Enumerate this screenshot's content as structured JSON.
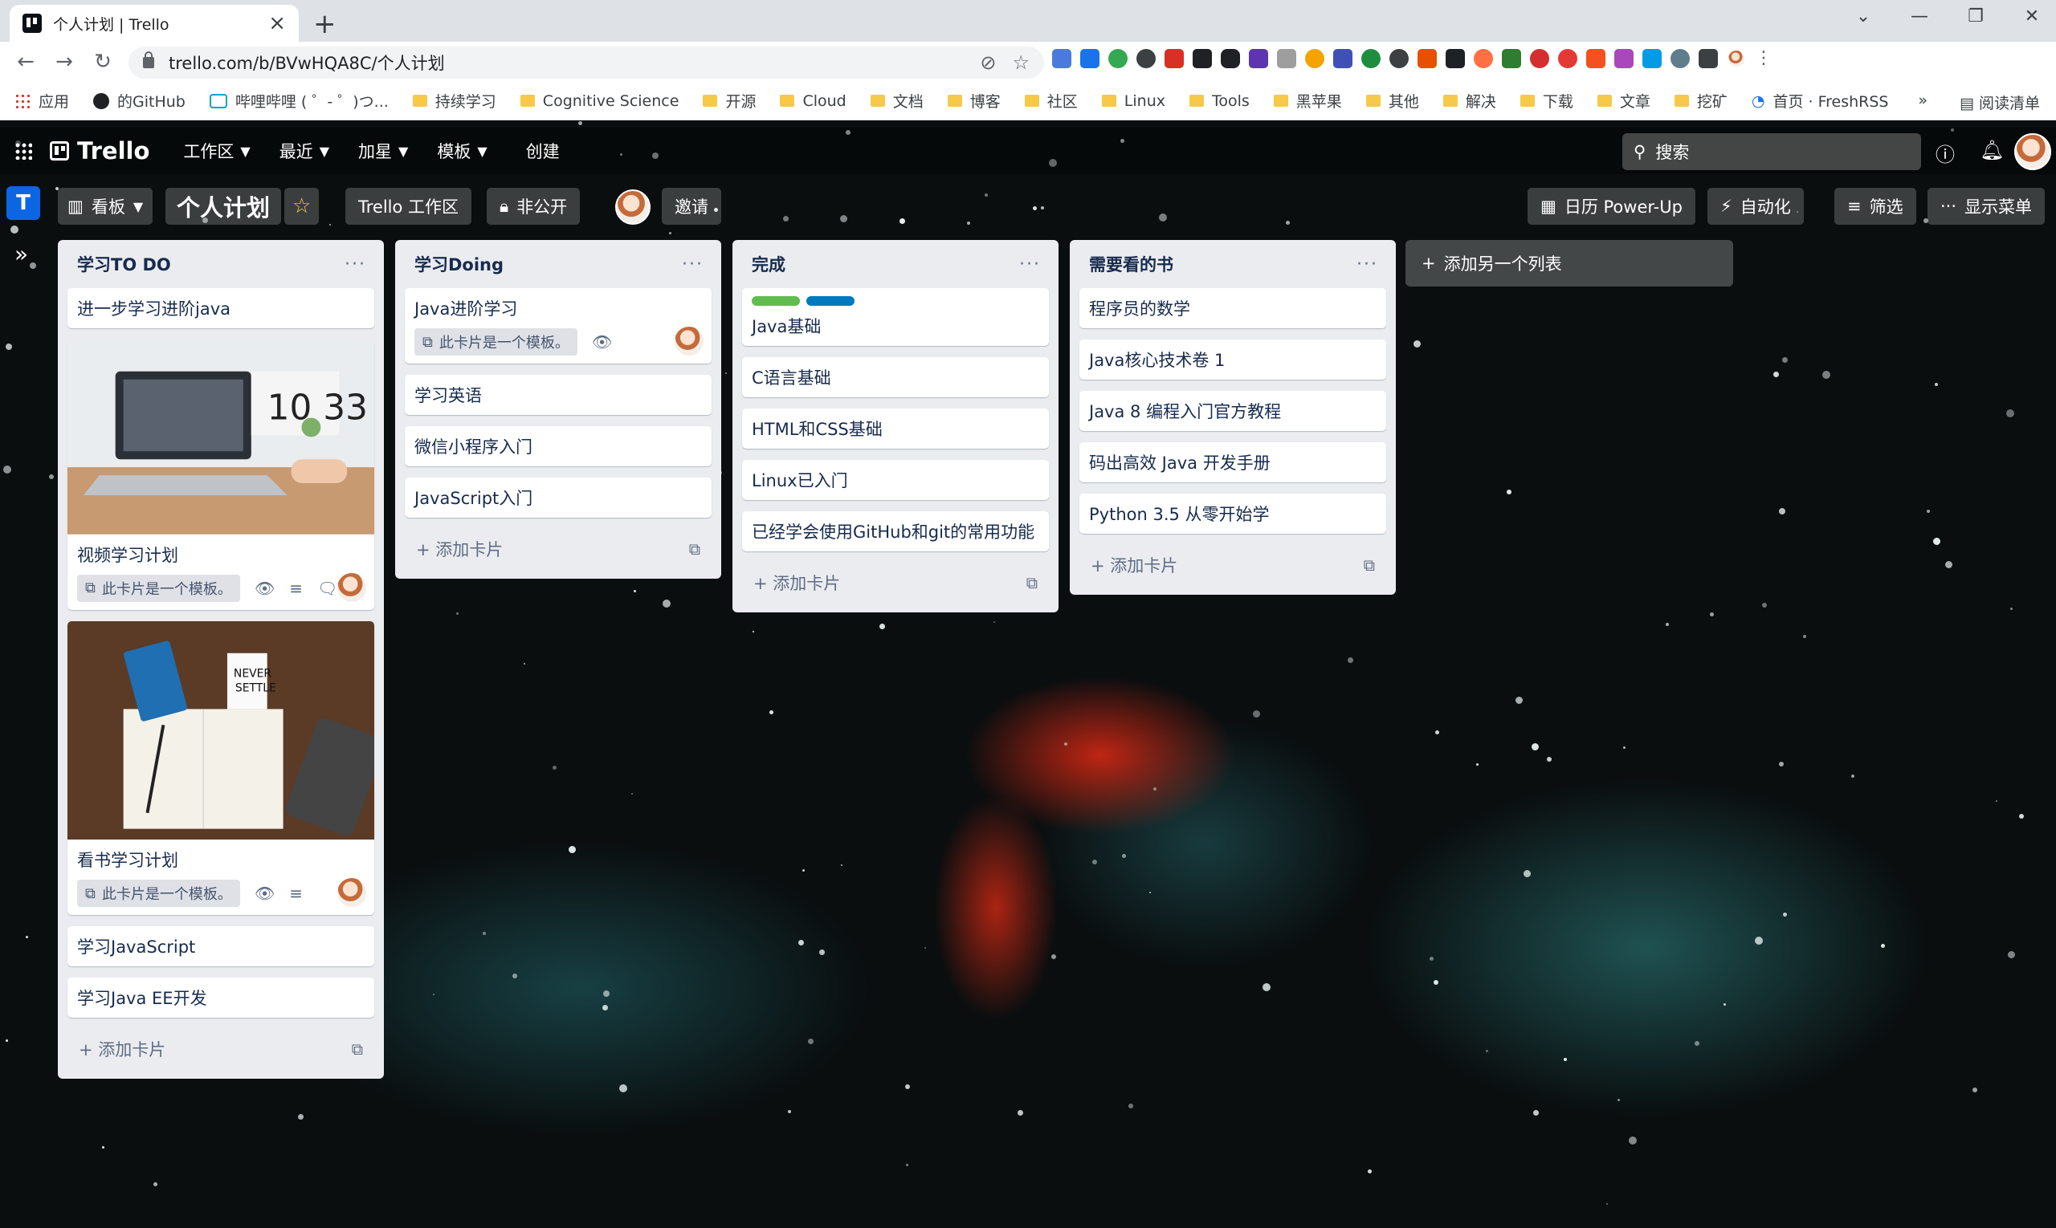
{
  "browser": {
    "tab_title": "个人计划 | Trello",
    "url": "trello.com/b/BVwHQA8C/个人计划",
    "window_controls": [
      "⌄",
      "—",
      "❐",
      "✕"
    ]
  },
  "bookmarks": {
    "items": [
      {
        "label": "应用",
        "icon": "apps-icon"
      },
      {
        "label": "的GitHub",
        "icon": "github-icon"
      },
      {
        "label": "哔哩哔哩 ( ゜- ゜)つ...",
        "icon": "bilibili-icon"
      },
      {
        "label": "持续学习",
        "icon": "folder-icon"
      },
      {
        "label": "Cognitive Science",
        "icon": "folder-icon"
      },
      {
        "label": "开源",
        "icon": "folder-icon"
      },
      {
        "label": "Cloud",
        "icon": "folder-icon"
      },
      {
        "label": "文档",
        "icon": "folder-icon"
      },
      {
        "label": "博客",
        "icon": "folder-icon"
      },
      {
        "label": "社区",
        "icon": "folder-icon"
      },
      {
        "label": "Linux",
        "icon": "folder-icon"
      },
      {
        "label": "Tools",
        "icon": "folder-icon"
      },
      {
        "label": "黑苹果",
        "icon": "folder-icon"
      },
      {
        "label": "其他",
        "icon": "folder-icon"
      },
      {
        "label": "解决",
        "icon": "folder-icon"
      },
      {
        "label": "下载",
        "icon": "folder-icon"
      },
      {
        "label": "文章",
        "icon": "folder-icon"
      },
      {
        "label": "挖矿",
        "icon": "folder-icon"
      },
      {
        "label": "首页 · FreshRSS",
        "icon": "rss-icon"
      }
    ],
    "more": "»",
    "reading_list": "阅读清单"
  },
  "trello_header": {
    "logo": "Trello",
    "menus": [
      "工作区",
      "最近",
      "加星",
      "模板"
    ],
    "create": "创建",
    "search_placeholder": "搜索"
  },
  "board_bar": {
    "workspace_badge": "T",
    "view": "看板",
    "title": "个人计划",
    "workspace": "Trello 工作区",
    "visibility": "非公开",
    "invite": "邀请",
    "calendar": "日历 Power-Up",
    "automation": "自动化",
    "filter": "筛选",
    "show_menu": "显示菜单"
  },
  "template_badge": "此卡片是一个模板。",
  "add_card": "添加卡片",
  "add_list": "添加另一个列表",
  "lists": [
    {
      "title": "学习TO DO",
      "cards": [
        {
          "title": "进一步学习进阶java"
        },
        {
          "title": "视频学习计划",
          "cover": "laptop",
          "template": true,
          "watch": true,
          "description": true,
          "comments": "1",
          "avatar": true
        },
        {
          "title": "看书学习计划",
          "cover": "desk",
          "template": true,
          "watch": true,
          "description": true,
          "avatar": true
        },
        {
          "title": "学习JavaScript"
        },
        {
          "title": "学习Java EE开发"
        }
      ]
    },
    {
      "title": "学习Doing",
      "cards": [
        {
          "title": "Java进阶学习",
          "template": true,
          "watch": true,
          "avatar": true
        },
        {
          "title": "学习英语"
        },
        {
          "title": "微信小程序入门"
        },
        {
          "title": "JavaScript入门"
        }
      ]
    },
    {
      "title": "完成",
      "cards": [
        {
          "title": "Java基础",
          "labels": [
            "#61bd4f",
            "#0079bf"
          ]
        },
        {
          "title": "C语言基础"
        },
        {
          "title": "HTML和CSS基础"
        },
        {
          "title": "Linux已入门"
        },
        {
          "title": "已经学会使用GitHub和git的常用功能"
        }
      ]
    },
    {
      "title": "需要看的书",
      "cards": [
        {
          "title": "程序员的数学"
        },
        {
          "title": "Java核心技术卷 1"
        },
        {
          "title": "Java 8 编程入门官方教程"
        },
        {
          "title": "码出高效 Java 开发手册"
        },
        {
          "title": "Python 3.5 从零开始学"
        }
      ]
    }
  ],
  "colors": {
    "board_badge": "#0c66e4",
    "list_bg": "#ebecf0",
    "star": "#f5cd47"
  }
}
